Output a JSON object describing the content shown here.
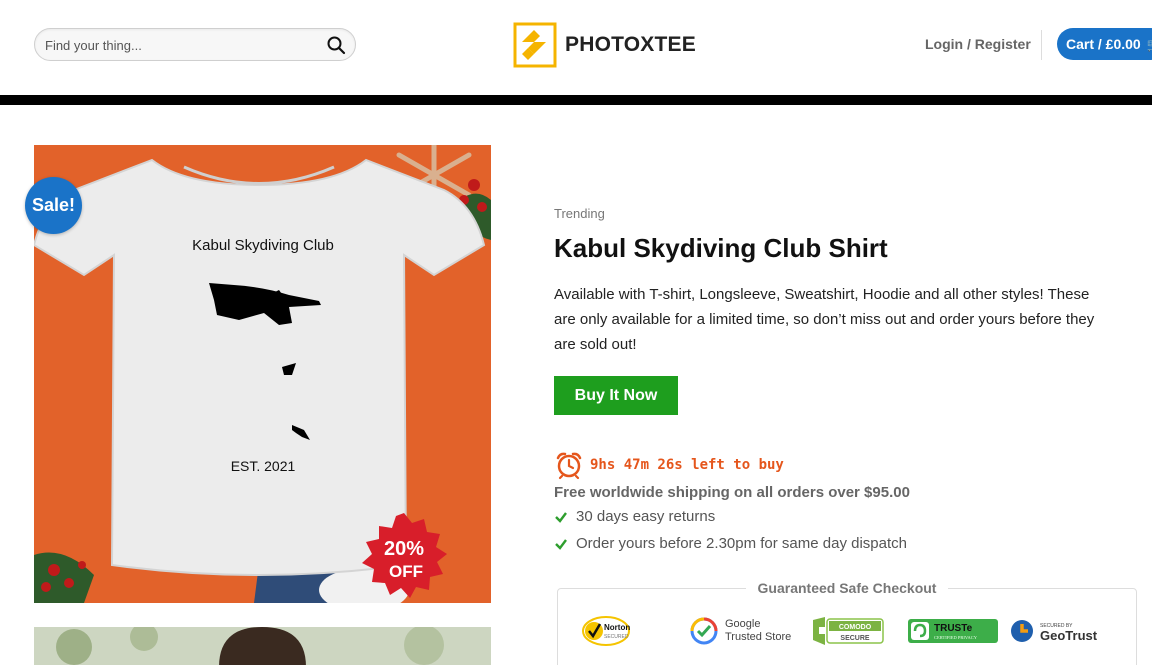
{
  "header": {
    "search_placeholder": "Find your thing...",
    "logo_text": "PHOTOXTEE",
    "login_label": "Login / Register",
    "cart_label": "Cart / £0.00"
  },
  "product": {
    "sale_badge": "Sale!",
    "category": "Trending",
    "title": "Kabul Skydiving Club Shirt",
    "description": "Available with T-shirt, Longsleeve, Sweatshirt, Hoodie and all other styles! These are only available for a limited time, so don’t miss out and order yours before they are sold out!",
    "buy_label": "Buy It Now",
    "timer": {
      "hours": "9",
      "minutes": "47",
      "seconds": "26",
      "text": "9hs 47m 26s left to buy"
    },
    "shipping": "Free worldwide shipping on all orders over $95.00",
    "features": [
      "30 days easy returns",
      "Order yours before 2.30pm for same day dispatch"
    ],
    "image": {
      "shirt_line1": "Kabul Skydiving Club",
      "shirt_line2": "EST. 2021",
      "discount_top": "20%",
      "discount_bottom": "OFF"
    }
  },
  "checkout": {
    "title": "Guaranteed Safe Checkout",
    "badges": {
      "norton": [
        "Norton",
        "SECURED"
      ],
      "google": [
        "Google",
        "Trusted Store"
      ],
      "comodo": [
        "COMODO",
        "SECURE"
      ],
      "truste": [
        "TRUSTe",
        "CERTIFIED PRIVACY"
      ],
      "geotrust": [
        "SECURED BY",
        "GeoTrust"
      ]
    }
  },
  "colors": {
    "accent_blue": "#1a73c8",
    "buy_green": "#1e9e1e",
    "timer_orange": "#e5561c",
    "backdrop_orange": "#e2622a"
  }
}
